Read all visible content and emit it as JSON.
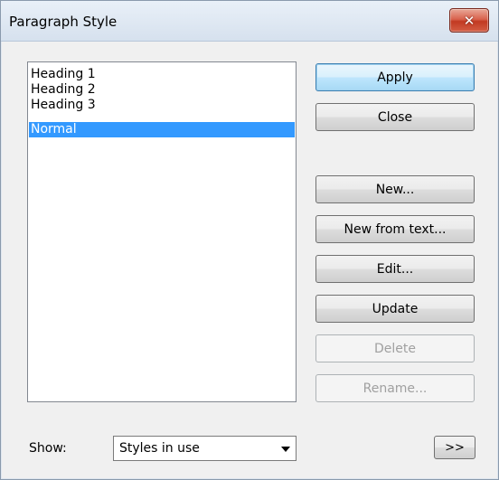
{
  "window": {
    "title": "Paragraph Style",
    "close_glyph": "✕"
  },
  "styles_list": {
    "items": [
      {
        "label": "Heading 1",
        "selected": false
      },
      {
        "label": "Heading 2",
        "selected": false
      },
      {
        "label": "Heading 3",
        "selected": false
      },
      {
        "label": "Normal",
        "selected": true
      }
    ]
  },
  "buttons": {
    "apply": "Apply",
    "close": "Close",
    "new": "New...",
    "new_from_text": "New from text...",
    "edit": "Edit...",
    "update": "Update",
    "delete": "Delete",
    "rename": "Rename..."
  },
  "show": {
    "label": "Show:",
    "selected": "Styles in use"
  },
  "more_button": ">>"
}
